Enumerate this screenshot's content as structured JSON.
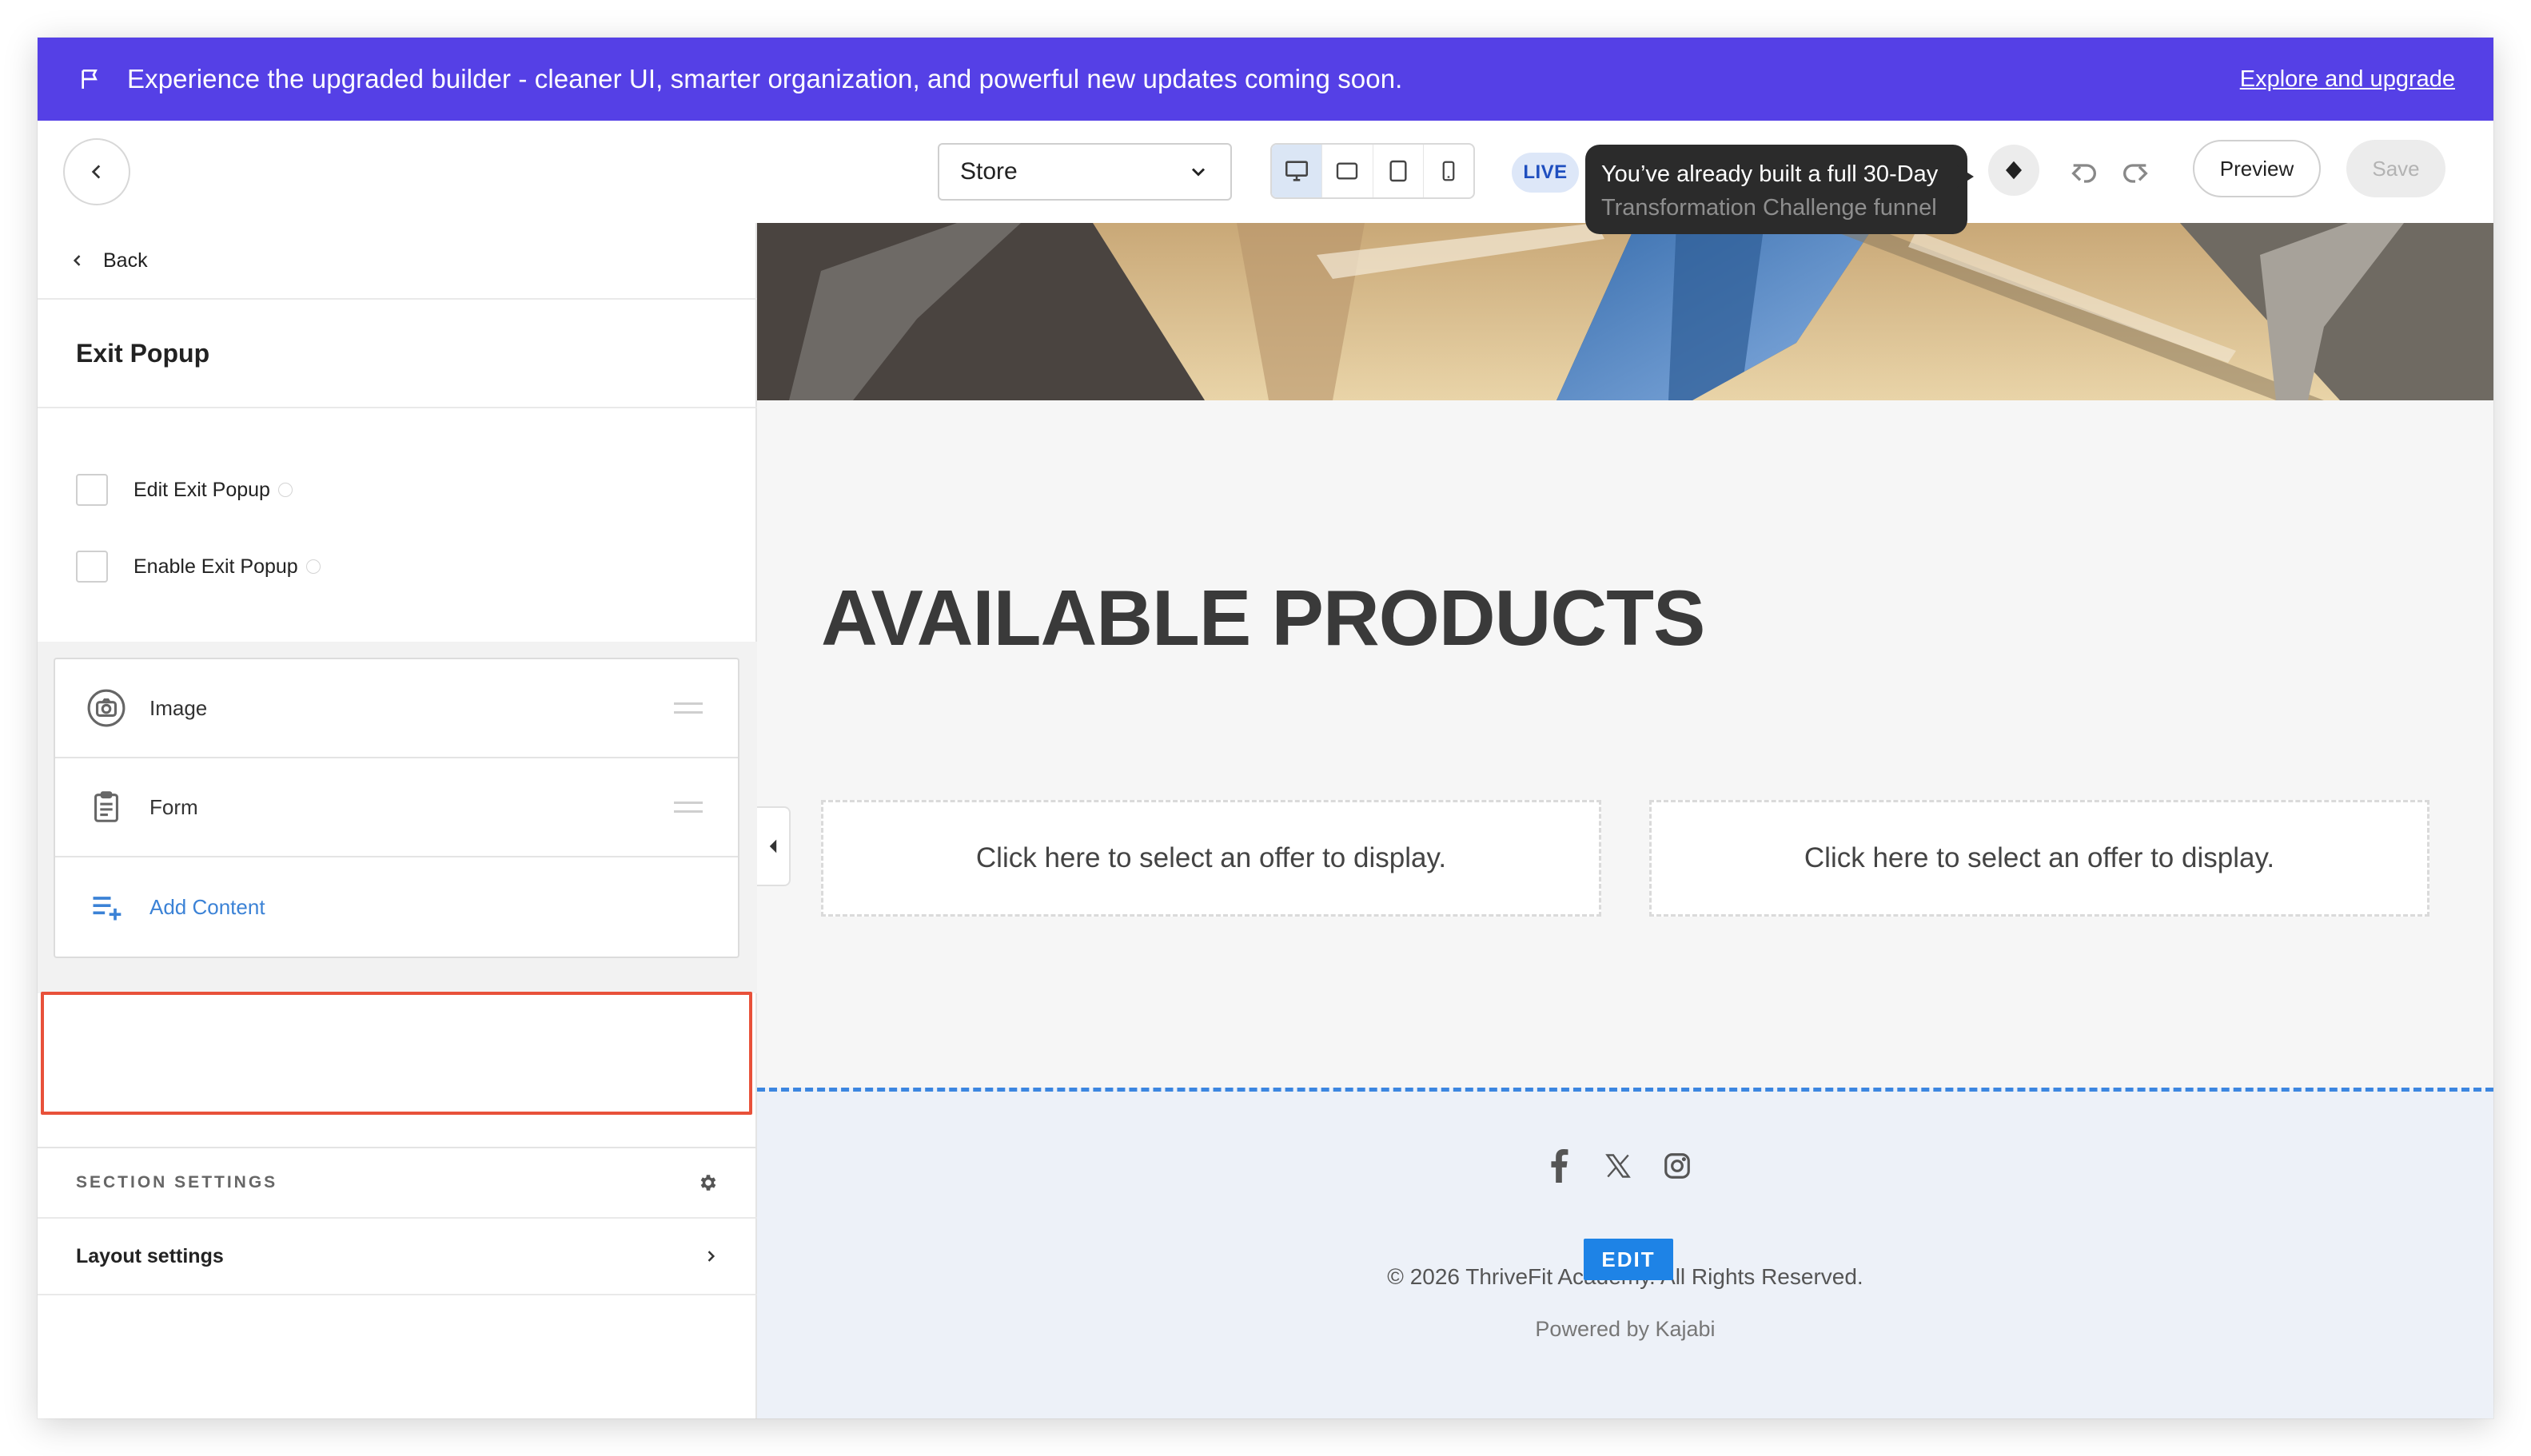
{
  "banner": {
    "message": "Experience the upgraded builder - cleaner UI, smarter organization, and powerful new updates coming soon.",
    "link": "Explore and upgrade",
    "color": "#5540e6"
  },
  "topbar": {
    "page_select": "Store",
    "live_badge": "LIVE",
    "tooltip_line1": "You’ve already built a full 30-Day",
    "tooltip_line2": "Transformation Challenge funnel",
    "preview_label": "Preview",
    "save_label": "Save",
    "devices": [
      "desktop-icon",
      "tablet-landscape-icon",
      "tablet-portrait-icon",
      "mobile-icon"
    ],
    "active_device": "desktop"
  },
  "sidebar": {
    "back_label": "Back",
    "section_title": "Exit Popup",
    "checkboxes": [
      {
        "label": "Edit Exit Popup",
        "checked": false
      },
      {
        "label": "Enable Exit Popup",
        "checked": false
      }
    ],
    "blocks": [
      {
        "label": "Image",
        "icon": "camera-icon"
      },
      {
        "label": "Form",
        "icon": "clipboard-icon"
      }
    ],
    "add_content_label": "Add Content",
    "section_settings_label": "SECTION SETTINGS",
    "layout_settings_label": "Layout settings"
  },
  "canvas": {
    "heading": "AVAILABLE PRODUCTS",
    "offers": [
      "Click here to select an offer to display.",
      "Click here to select an offer to display."
    ],
    "footer": {
      "social_icons": [
        "facebook-icon",
        "x-icon",
        "instagram-icon"
      ],
      "edit_badge": "EDIT",
      "copyright": "© 2026 ThriveFit Academy. All Rights Reserved.",
      "powered_by": "Powered by Kajabi"
    }
  },
  "colors": {
    "accent_blue": "#3b82d6",
    "highlight_red": "#e8513a",
    "edit_badge": "#1e83e6"
  }
}
